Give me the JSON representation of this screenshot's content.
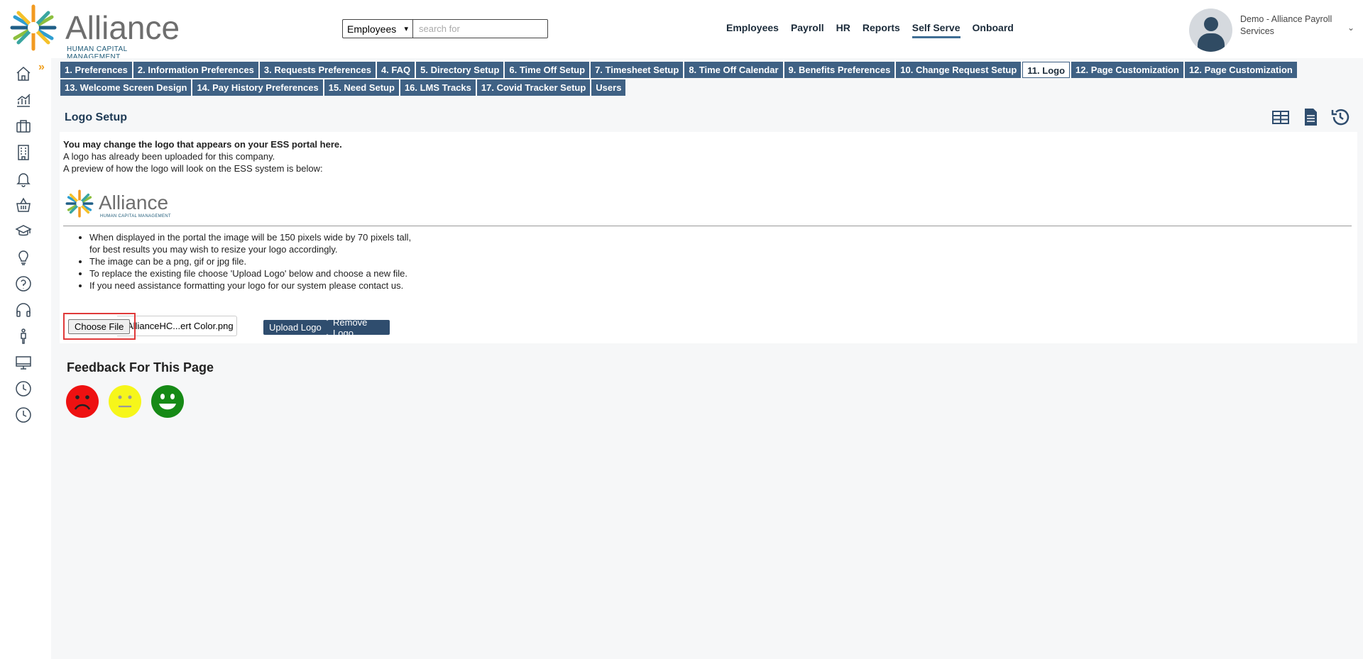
{
  "header": {
    "logo": {
      "word": "Alliance",
      "sub": "HUMAN CAPITAL MANAGEMENT"
    },
    "search": {
      "scope": "Employees",
      "placeholder": "search for"
    },
    "nav": [
      {
        "label": "Employees"
      },
      {
        "label": "Payroll"
      },
      {
        "label": "HR"
      },
      {
        "label": "Reports"
      },
      {
        "label": "Self Serve",
        "active": true
      },
      {
        "label": "Onboard"
      }
    ],
    "user": {
      "name": "Demo - Alliance Payroll Services"
    }
  },
  "sidebar": {
    "icons": [
      "home-icon",
      "chart-icon",
      "briefcase-icon",
      "building-icon",
      "bell-icon",
      "basket-icon",
      "graduation-cap-icon",
      "lightbulb-icon",
      "help-icon",
      "headphones-icon",
      "person-icon",
      "desktop-icon",
      "clock-icon",
      "clock-icon"
    ]
  },
  "tabs": {
    "row1": [
      "1. Preferences",
      "2. Information Preferences",
      "3. Requests Preferences",
      "4. FAQ",
      "5. Directory Setup",
      "6. Time Off Setup",
      "7. Timesheet Setup",
      "8. Time Off Calendar",
      "9. Benefits Preferences",
      "10. Change Request Setup",
      "11. Logo",
      "12. Page Customization",
      "12. Page Customization"
    ],
    "row2": [
      "13. Welcome Screen Design",
      "14. Pay History Preferences",
      "15. Need Setup",
      "16. LMS Tracks",
      "17. Covid Tracker Setup",
      "Users"
    ],
    "active": "11. Logo"
  },
  "main": {
    "title": "Logo Setup",
    "intro_bold": "You may change the logo that appears on your ESS portal here.",
    "line1": "A logo has already been uploaded for this company.",
    "line2": "A preview of how the logo will look on the ESS system is below:",
    "preview_logo": {
      "word": "Alliance",
      "sub": "HUMAN CAPITAL MANAGEMENT"
    },
    "bullets": {
      "b1a": "When displayed in the portal the image will be 150 pixels wide by 70 pixels tall,",
      "b1b": "for best results you may wish to resize your logo accordingly.",
      "b2": "The image can be a png, gif or jpg file.",
      "b3": "To replace the existing file choose 'Upload Logo' below and choose a new file.",
      "b4": "If you need assistance formatting your logo for our system please contact us."
    },
    "file": {
      "choose_label": "Choose File",
      "file_name": "AllianceHC...ert Color.png",
      "upload_label": "Upload Logo",
      "remove_label": "Remove Logo"
    }
  },
  "feedback": {
    "title": "Feedback For This Page",
    "faces": [
      {
        "name": "sad",
        "color": "#ee1111"
      },
      {
        "name": "neutral",
        "color": "#f6f61a"
      },
      {
        "name": "happy",
        "color": "#168a16"
      }
    ]
  },
  "colors": {
    "tab_bg": "#3f6184",
    "button_bg": "#2f4d6e",
    "highlight": "#e03a3a",
    "nav_underline": "#3f6e95",
    "sidebar_expand": "#f0a020"
  }
}
